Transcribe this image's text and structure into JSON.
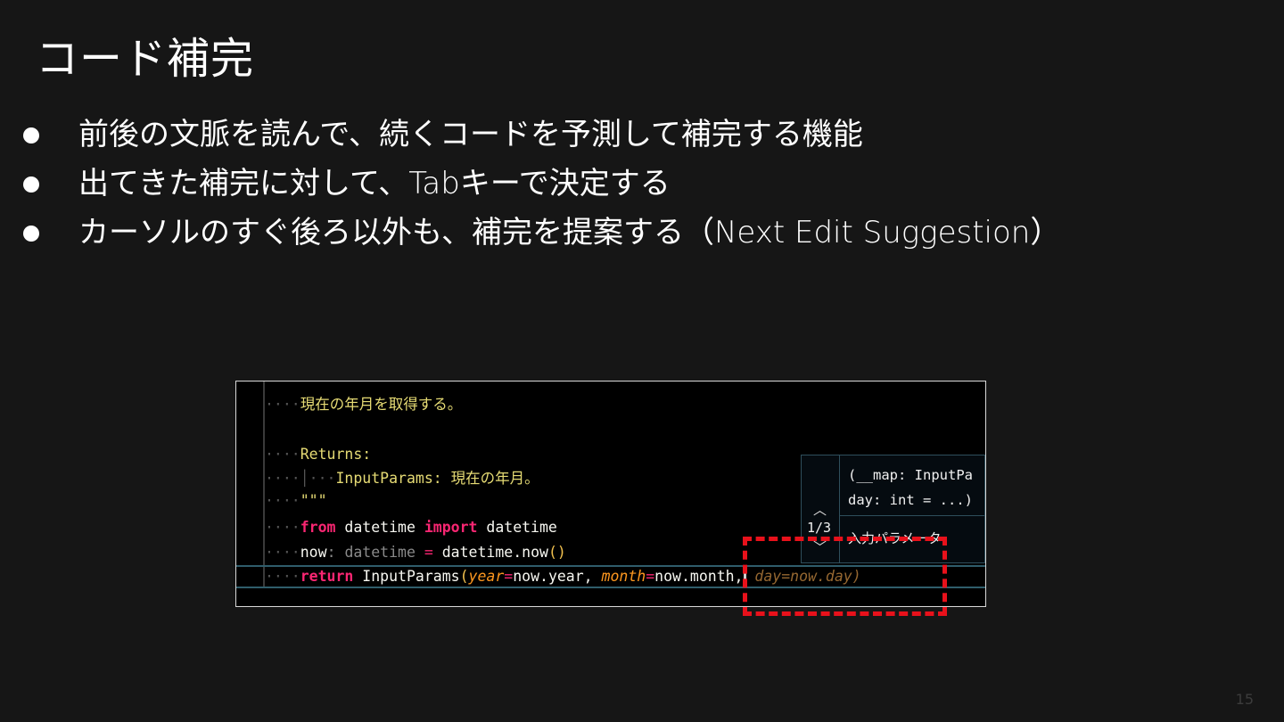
{
  "slide": {
    "title": "コード補完",
    "bullets": [
      "前後の文脈を読んで、続くコードを予測して補完する機能",
      "出てきた補完に対して、Tabキーで決定する",
      "カーソルのすぐ後ろ以外も、補完を提案する（Next Edit Suggestion）"
    ],
    "page_number": "15"
  },
  "code": {
    "docline1": "現在の年月を取得する。",
    "returns": "Returns:",
    "returns_detail": "InputParams: 現在の年月。",
    "docquote": "\"\"\"",
    "from_kw": "from",
    "from_mod": " datetime ",
    "import_kw": "import",
    "import_name": " datetime",
    "now_name": "now",
    "now_colon": ": ",
    "now_type": "datetime",
    "now_eq": " = ",
    "now_call": "datetime.now",
    "now_parens": "()",
    "return_kw": "return",
    "ret_cls": " InputParams",
    "ret_open": "(",
    "arg_year": "year",
    "eq": "=",
    "val_year": "now.year, ",
    "arg_month": "month",
    "val_month": "now.month,",
    "ghost": " day=now.day)"
  },
  "popup": {
    "sig_line1": "(__map: InputPa",
    "sig_line2": "day: int = ...)",
    "count": "1/3",
    "description": "入力パラメータ"
  },
  "colors": {
    "background": "#161616",
    "highlight": "#e8111b",
    "keyword": "#f92672",
    "docstring": "#e6db74"
  }
}
